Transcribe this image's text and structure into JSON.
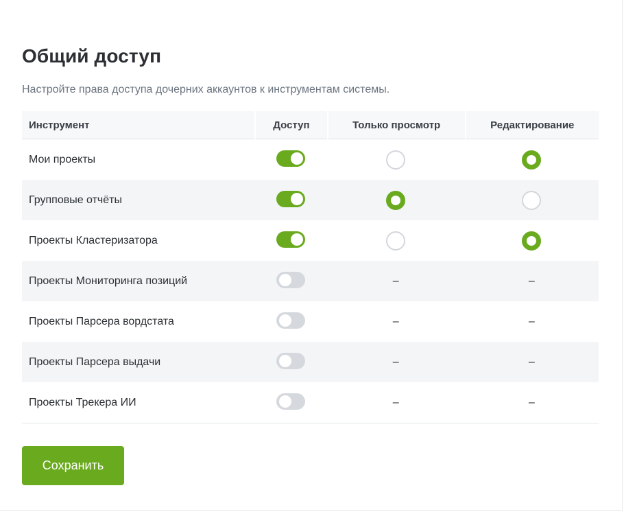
{
  "page": {
    "title": "Общий доступ",
    "subtitle": "Настройте права доступа дочерних аккаунтов к инструментам системы."
  },
  "table": {
    "headers": {
      "tool": "Инструмент",
      "access": "Доступ",
      "view_only": "Только просмотр",
      "edit": "Редактирование"
    },
    "rows": [
      {
        "name": "Мои проекты",
        "access": true,
        "permission": "edit"
      },
      {
        "name": "Групповые отчёты",
        "access": true,
        "permission": "view_only"
      },
      {
        "name": "Проекты Кластеризатора",
        "access": true,
        "permission": "edit"
      },
      {
        "name": "Проекты Мониторинга позиций",
        "access": false,
        "permission": null
      },
      {
        "name": "Проекты Парсера вордстата",
        "access": false,
        "permission": null
      },
      {
        "name": "Проекты Парсера выдачи",
        "access": false,
        "permission": null
      },
      {
        "name": "Проекты Трекера ИИ",
        "access": false,
        "permission": null
      }
    ],
    "disabled_placeholder": "–"
  },
  "actions": {
    "save_label": "Сохранить"
  },
  "colors": {
    "accent": "#6aaa1e",
    "toggle_off": "#d5d9de",
    "row_alt": "#f3f5f7",
    "header_bg": "#f6f8fa"
  }
}
